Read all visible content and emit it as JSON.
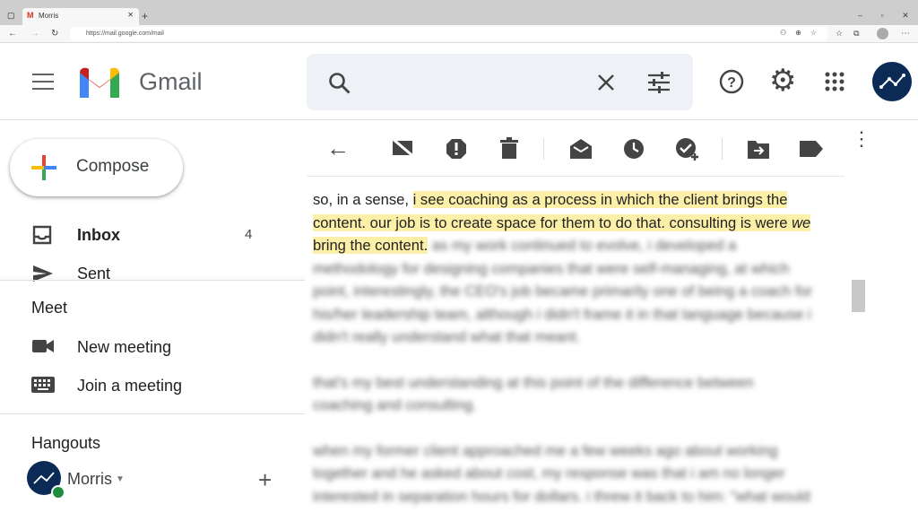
{
  "browser": {
    "tab_title": "Morris",
    "url": "https://mail.google.com/mail"
  },
  "header": {
    "app_name": "Gmail"
  },
  "sidebar": {
    "compose_label": "Compose",
    "items": [
      {
        "label": "Inbox",
        "count": "4"
      },
      {
        "label": "Sent"
      }
    ],
    "meet": {
      "title": "Meet",
      "items": [
        {
          "label": "New meeting"
        },
        {
          "label": "Join a meeting"
        }
      ]
    },
    "hangouts": {
      "title": "Hangouts",
      "user": "Morris"
    }
  },
  "toolbar": {
    "icons": [
      "back",
      "mark-unread",
      "report-spam",
      "delete",
      "move-to-inbox",
      "snooze",
      "add-task",
      "move-to",
      "label",
      "more"
    ]
  },
  "email": {
    "p1_plain": "so, in a sense, ",
    "p1_hl1": "i see coaching as a process in which the client brings the content. our job is to create space for them to do that. consulting is were ",
    "p1_hl_em": "we",
    "p1_hl2": " bring the content.",
    "p1_blur": " as my work continued to evolve, i developed a methodology for designing companies that were self-managing, at which point, interestingly, the CEO's job became primarily one of being a coach for his/her leadership team, although i didn't frame it in that language because i didn't really understand what that meant.",
    "p2_blur": "that's my best understanding at this point of the difference between coaching and consulting.",
    "p3_blur": "when my former client approached me a few weeks ago about working together and he asked about cost, my response was that i am no longer interested in separation hours for dollars. i threw it back to him: \"what would"
  },
  "colors": {
    "highlight": "#fcefa8",
    "avatar": "#0b2a55",
    "online": "#1e8e3e"
  }
}
